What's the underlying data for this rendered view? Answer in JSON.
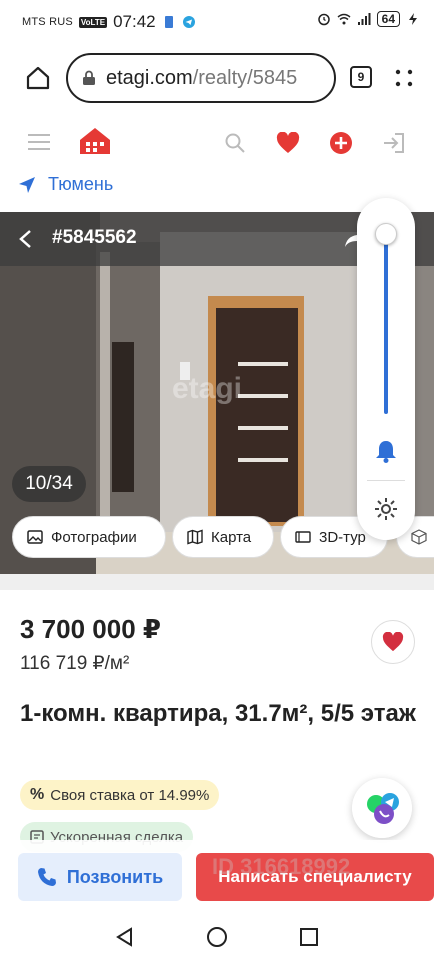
{
  "status_bar": {
    "carrier": "MTS RUS",
    "volte": "VoLTE",
    "time": "07:42",
    "battery": "64"
  },
  "browser": {
    "url_host": "etagi.com",
    "url_path": "/realty/5845",
    "tab_count": "9"
  },
  "header": {
    "city": "Тюмень"
  },
  "gallery": {
    "listing_id": "#5845562",
    "watermark": "etagi",
    "counter": "10/34",
    "chips": [
      {
        "label": "Фотографии",
        "icon": "image-icon"
      },
      {
        "label": "Карта",
        "icon": "map-icon"
      },
      {
        "label": "3D-тур",
        "icon": "3d-tour-icon"
      },
      {
        "label": "",
        "icon": "cube-icon"
      }
    ]
  },
  "volume": {
    "level": 0.95
  },
  "listing": {
    "price": "3 700 000 ₽",
    "price_per_sqm": "116 719 ₽/м²",
    "title": "1-комн. квартира, 31.7м², 5/5 этаж",
    "rate_icon": "%",
    "rate_text": "Своя ставка от 14.99%",
    "deal_text": "Ускоренная сделка"
  },
  "actions": {
    "call_label": "Позвонить",
    "write_label": "Написать специалисту",
    "id_watermark": "ID 316618992"
  },
  "colors": {
    "accent_blue": "#2f6fd6",
    "accent_red": "#e84a4a",
    "brand_red": "#e53935"
  }
}
